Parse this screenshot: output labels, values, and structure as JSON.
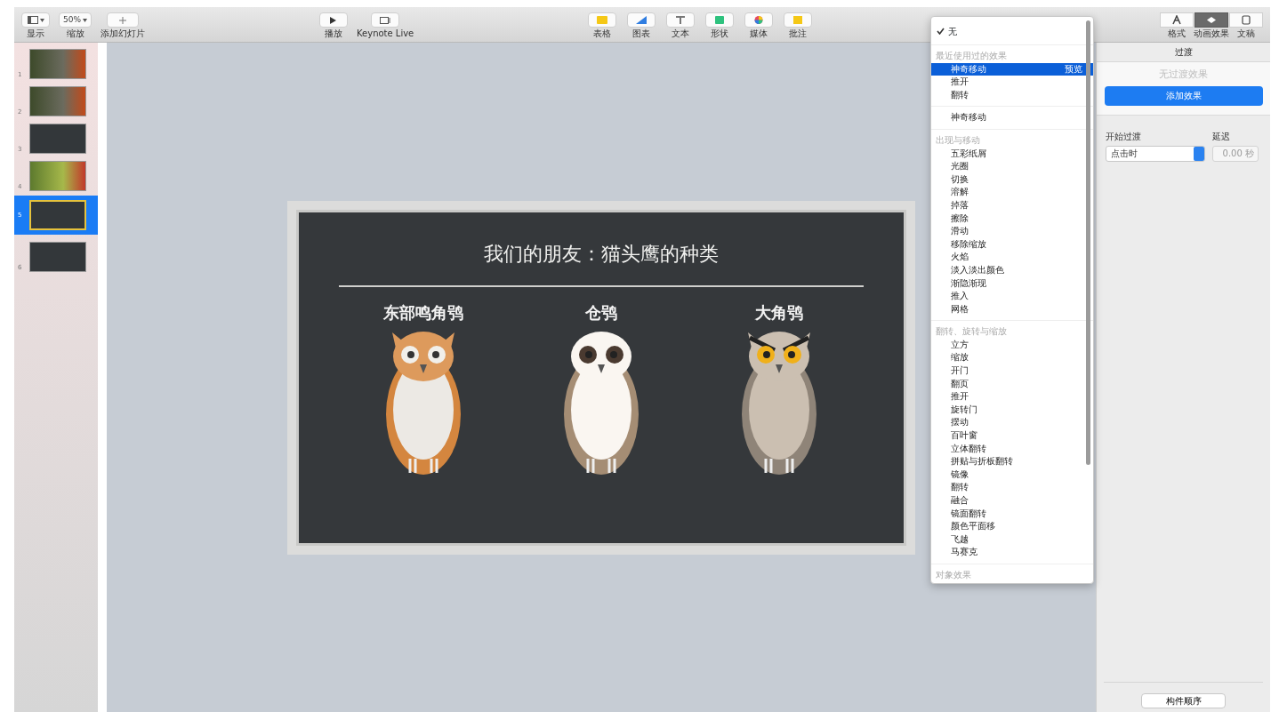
{
  "toolbar": {
    "left": [
      {
        "label": "显示"
      },
      {
        "label": "缩放",
        "value": "50%"
      },
      {
        "label": "添加幻灯片"
      }
    ],
    "play": [
      {
        "label": "播放"
      },
      {
        "label": "Keynote Live"
      }
    ],
    "insert": [
      {
        "label": "表格"
      },
      {
        "label": "图表"
      },
      {
        "label": "文本"
      },
      {
        "label": "形状"
      },
      {
        "label": "媒体"
      },
      {
        "label": "批注"
      }
    ],
    "inspectors": [
      {
        "label": "格式",
        "selected": false
      },
      {
        "label": "动画效果",
        "selected": true
      },
      {
        "label": "文稿",
        "selected": false
      }
    ]
  },
  "slides": [
    {
      "number": "1",
      "kind": "photo",
      "selected": false
    },
    {
      "number": "2",
      "kind": "photo",
      "selected": false
    },
    {
      "number": "3",
      "kind": "dark",
      "selected": false
    },
    {
      "number": "4",
      "kind": "forest",
      "selected": false
    },
    {
      "number": "5",
      "kind": "dark",
      "selected": true
    },
    {
      "number": "6",
      "kind": "dark",
      "selected": false
    }
  ],
  "slide": {
    "title": "我们的朋友：猫头鹰的种类",
    "owls": [
      {
        "name": "东部鸣角鸮",
        "kind": "horned"
      },
      {
        "name": "仓鸮",
        "kind": "barn"
      },
      {
        "name": "大角鸮",
        "kind": "great"
      }
    ]
  },
  "menu": {
    "none": {
      "label": "无",
      "checked": true
    },
    "sections": [
      {
        "header": "最近使用过的效果",
        "items": [
          {
            "label": "神奇移动",
            "selected": true,
            "hint": "预览"
          },
          {
            "label": "推开",
            "selected": false
          },
          {
            "label": "翻转",
            "selected": false
          }
        ]
      },
      {
        "items": [
          {
            "label": "神奇移动",
            "selected": false
          }
        ]
      },
      {
        "header": "出现与移动",
        "items": [
          {
            "label": "五彩纸屑",
            "selected": false
          },
          {
            "label": "光圈",
            "selected": false
          },
          {
            "label": "切换",
            "selected": false
          },
          {
            "label": "溶解",
            "selected": false
          },
          {
            "label": "掉落",
            "selected": false
          },
          {
            "label": "擦除",
            "selected": false
          },
          {
            "label": "滑动",
            "selected": false
          },
          {
            "label": "移除缩放",
            "selected": false
          },
          {
            "label": "火焰",
            "selected": false
          },
          {
            "label": "淡入淡出颜色",
            "selected": false
          },
          {
            "label": "渐隐渐现",
            "selected": false
          },
          {
            "label": "推入",
            "selected": false
          },
          {
            "label": "网格",
            "selected": false
          }
        ]
      },
      {
        "header": "翻转、旋转与缩放",
        "items": [
          {
            "label": "立方",
            "selected": false
          },
          {
            "label": "缩放",
            "selected": false
          },
          {
            "label": "开门",
            "selected": false
          },
          {
            "label": "翻页",
            "selected": false
          },
          {
            "label": "推开",
            "selected": false
          },
          {
            "label": "旋转门",
            "selected": false
          },
          {
            "label": "摆动",
            "selected": false
          },
          {
            "label": "百叶窗",
            "selected": false
          },
          {
            "label": "立体翻转",
            "selected": false
          },
          {
            "label": "拼贴与折板翻转",
            "selected": false
          },
          {
            "label": "镜像",
            "selected": false
          },
          {
            "label": "翻转",
            "selected": false
          },
          {
            "label": "融合",
            "selected": false
          },
          {
            "label": "镜面翻转",
            "selected": false
          },
          {
            "label": "颜色平面移",
            "selected": false
          },
          {
            "label": "飞越",
            "selected": false
          },
          {
            "label": "马赛克",
            "selected": false
          }
        ]
      },
      {
        "header": "对象效果"
      }
    ]
  },
  "inspector": {
    "tab": {
      "label": "过渡",
      "selected": true
    },
    "empty": "无过渡效果",
    "add_button": "添加效果",
    "start_label": "开始过渡",
    "start_value": "点击时",
    "delay_label": "延迟",
    "delay_value": "0.00 秒",
    "order_button": "构件顺序"
  }
}
